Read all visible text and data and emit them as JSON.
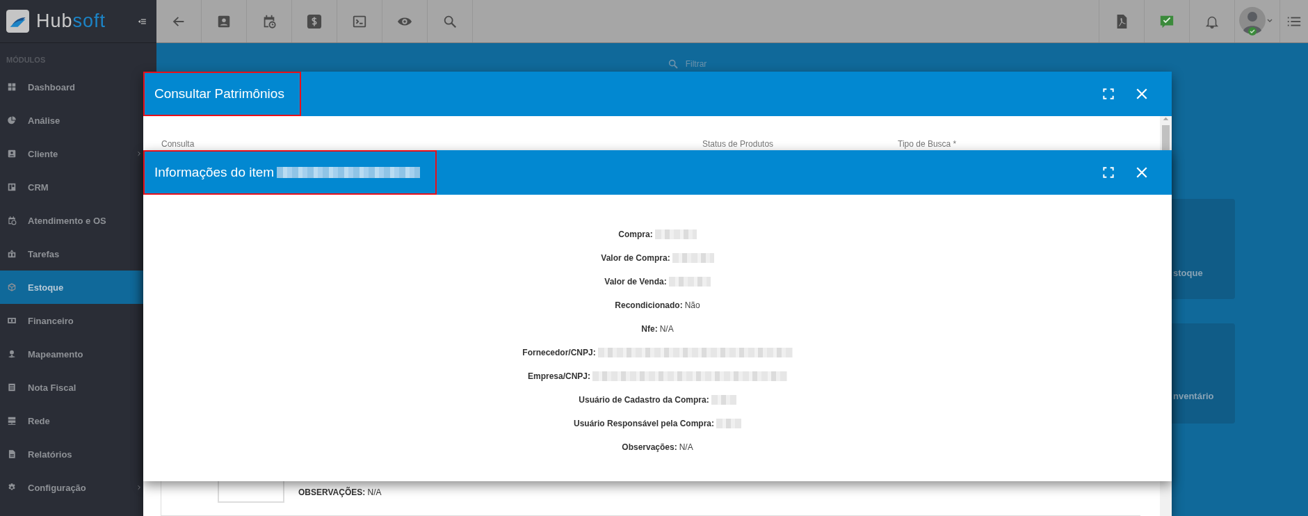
{
  "logo": {
    "parts": [
      {
        "text": "Hub",
        "color": "#c9c9c9"
      },
      {
        "text": "soft",
        "color": "#1c84c6"
      }
    ]
  },
  "sidebar": {
    "heading": "MÓDULOS",
    "items": [
      {
        "label": "Dashboard",
        "selected": false,
        "has_submenu": false
      },
      {
        "label": "Análise",
        "selected": false,
        "has_submenu": false
      },
      {
        "label": "Cliente",
        "selected": false,
        "has_submenu": true
      },
      {
        "label": "CRM",
        "selected": false,
        "has_submenu": false
      },
      {
        "label": "Atendimento e OS",
        "selected": false,
        "has_submenu": false
      },
      {
        "label": "Tarefas",
        "selected": false,
        "has_submenu": false
      },
      {
        "label": "Estoque",
        "selected": true,
        "has_submenu": false
      },
      {
        "label": "Financeiro",
        "selected": false,
        "has_submenu": false
      },
      {
        "label": "Mapeamento",
        "selected": false,
        "has_submenu": false
      },
      {
        "label": "Nota Fiscal",
        "selected": false,
        "has_submenu": false
      },
      {
        "label": "Rede",
        "selected": false,
        "has_submenu": false
      },
      {
        "label": "Relatórios",
        "selected": false,
        "has_submenu": false
      },
      {
        "label": "Configuração",
        "selected": false,
        "has_submenu": true
      }
    ]
  },
  "filter": {
    "placeholder": "Filtrar"
  },
  "cards": [
    {
      "label": "stoque"
    },
    {
      "label": "nventário"
    }
  ],
  "modals": [
    {
      "title": "Consultar Patrimônios",
      "highlighted": true,
      "fields": [
        {
          "label": "Consulta"
        },
        {
          "label": "Status de Produtos"
        },
        {
          "label": "Tipo de Busca *"
        }
      ],
      "list_item": {
        "label": "OBSERVAÇÕES:",
        "value": "N/A"
      }
    },
    {
      "title": "Informações do item",
      "title_redacted": true,
      "highlighted": true,
      "rows": [
        {
          "label": "Compra:",
          "kind": "short"
        },
        {
          "label": "Valor de Compra:",
          "kind": "short"
        },
        {
          "label": "Valor de Venda:",
          "kind": "short"
        },
        {
          "label": "Recondicionado:",
          "kind": "text",
          "value": "Não"
        },
        {
          "label": "Nfe:",
          "kind": "text",
          "value": "N/A"
        },
        {
          "label": "Fornecedor/CNPJ:",
          "kind": "long"
        },
        {
          "label": "Empresa/CNPJ:",
          "kind": "long"
        },
        {
          "label": "Usuário de Cadastro da Compra:",
          "kind": "tiny"
        },
        {
          "label": "Usuário Responsável pela Compra:",
          "kind": "tiny"
        },
        {
          "label": "Observações:",
          "kind": "text",
          "value": "N/A"
        }
      ]
    }
  ]
}
